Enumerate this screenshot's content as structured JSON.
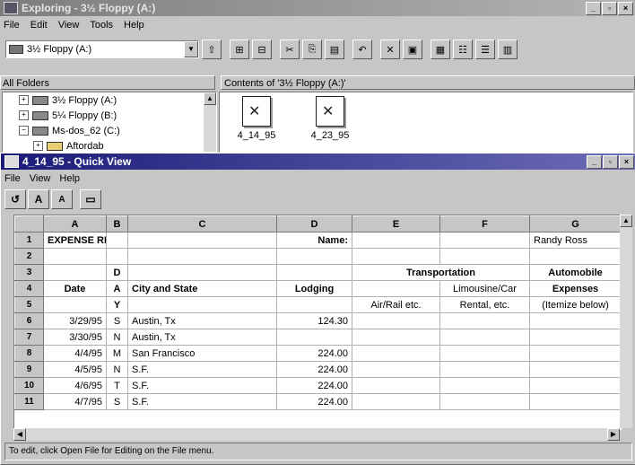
{
  "explorer": {
    "title": "Exploring - 3½ Floppy (A:)",
    "menu": [
      "File",
      "Edit",
      "View",
      "Tools",
      "Help"
    ],
    "drive_combo_value": "3½ Floppy (A:)",
    "all_folders_header": "All Folders",
    "contents_header": "Contents of '3½ Floppy (A:)'",
    "tree": [
      {
        "label": "3½ Floppy (A:)",
        "expander": "+"
      },
      {
        "label": "5¼ Floppy (B:)",
        "expander": "+"
      },
      {
        "label": "Ms-dos_62 (C:)",
        "expander": "−"
      },
      {
        "label": "Aftordab",
        "expander": "+"
      }
    ],
    "files": [
      {
        "name": "4_14_95"
      },
      {
        "name": "4_23_95"
      }
    ]
  },
  "quickview": {
    "title": "4_14_95 - Quick View",
    "menu": [
      "File",
      "View",
      "Help"
    ],
    "toolbar": [
      "↺",
      "A",
      "A",
      "▭"
    ],
    "columns": [
      "",
      "A",
      "B",
      "C",
      "D",
      "E",
      "F",
      "G"
    ],
    "rows": [
      {
        "n": "1",
        "cells": [
          "EXPENSE REPORT",
          "",
          "",
          "Name:",
          "",
          "",
          "Randy Ross"
        ]
      },
      {
        "n": "2",
        "cells": [
          "",
          "",
          "",
          "",
          "",
          "",
          ""
        ]
      },
      {
        "n": "3",
        "cells": [
          "",
          "D",
          "",
          "",
          "Transportation",
          "",
          "Automobile"
        ]
      },
      {
        "n": "4",
        "cells": [
          "Date",
          "A",
          "City and State",
          "Lodging",
          "",
          "Limousine/Car",
          "Expenses"
        ]
      },
      {
        "n": "5",
        "cells": [
          "",
          "Y",
          "",
          "",
          "Air/Rail etc.",
          "Rental, etc.",
          "(Itemize below)"
        ]
      },
      {
        "n": "6",
        "cells": [
          "3/29/95",
          "S",
          "Austin, Tx",
          "124.30",
          "",
          "",
          ""
        ]
      },
      {
        "n": "7",
        "cells": [
          "3/30/95",
          "N",
          "Austin, Tx",
          "",
          "",
          "",
          ""
        ]
      },
      {
        "n": "8",
        "cells": [
          "4/4/95",
          "M",
          "San Francisco",
          "224.00",
          "",
          "",
          ""
        ]
      },
      {
        "n": "9",
        "cells": [
          "4/5/95",
          "N",
          "S.F.",
          "224.00",
          "",
          "",
          ""
        ]
      },
      {
        "n": "10",
        "cells": [
          "4/6/95",
          "T",
          "S.F.",
          "224.00",
          "",
          "",
          ""
        ]
      },
      {
        "n": "11",
        "cells": [
          "4/7/95",
          "S",
          "S.F.",
          "224.00",
          "",
          "",
          ""
        ]
      }
    ],
    "status": "To edit, click Open File for Editing on the File menu."
  }
}
